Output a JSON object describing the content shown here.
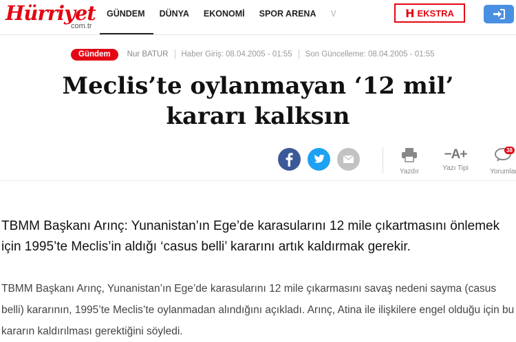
{
  "header": {
    "logo_text": "Hürriyet",
    "logo_sub": "com.tr",
    "nav": [
      "GÜNDEM",
      "DÜNYA",
      "EKONOMİ",
      "SPOR ARENA",
      "V"
    ],
    "ekstra_icon": "H",
    "ekstra_label": "EKSTRA",
    "login_icon": "sign-in-icon"
  },
  "article": {
    "category": "Gündem",
    "author": "Nur BATUR",
    "published": "Haber Giriş: 08.04.2005 - 01:55",
    "updated": "Son Güncelleme: 08.04.2005 - 01:55",
    "title_line1": "Meclis’te oylanmayan ‘12 mil’",
    "title_line2": "kararı kalksın",
    "lead": "TBMM Başkanı Arınç: Yunanistan’ın Ege’de karasularını 12 mile çıkartmasını önlemek için 1995’te Meclis’in aldığı ‘casus belli’ kararını artık kaldırmak gerekir.",
    "body": "TBMM Başkanı Arınç, Yunanistan’ın Ege’de karasularını 12 mile çıkarmasını savaş nedeni sayma (casus belli) kararının, 1995’te Meclis’te oylanmadan alındığını açıkladı. Arınç, Atina ile ilişkilere engel olduğu için bu kararın kaldırılması gerektiğini söyledi."
  },
  "tools": {
    "print_label": "Yazdır",
    "font_symbol": "−A+",
    "font_label": "Yazı Tipi",
    "comments_label": "Yorumlar",
    "comments_count": "38"
  },
  "colors": {
    "brand_red": "#e30613",
    "facebook": "#3b5998",
    "twitter": "#1da1f2",
    "email": "#c2c2c2",
    "login_blue": "#4a90e2"
  },
  "icons": [
    "facebook-icon",
    "twitter-icon",
    "email-icon",
    "print-icon",
    "comment-icon"
  ]
}
